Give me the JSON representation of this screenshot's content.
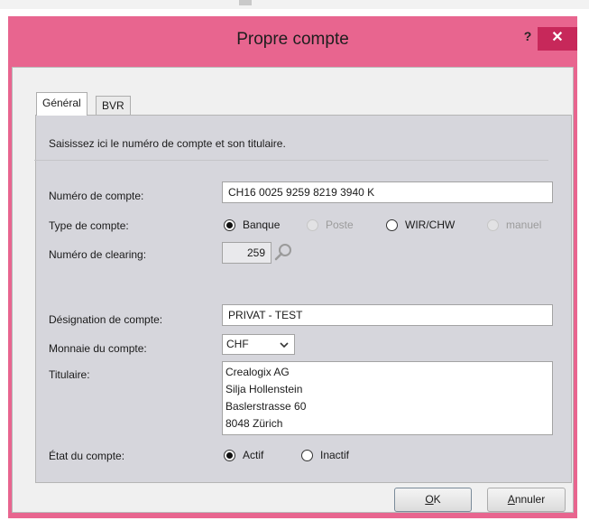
{
  "window": {
    "title": "Propre compte",
    "help_label": "?",
    "close_label": "✕"
  },
  "tabs": [
    {
      "label": "Général"
    },
    {
      "label": "BVR"
    }
  ],
  "intro": "Saisissez ici le numéro de compte et son titulaire.",
  "account_number": {
    "label": "Numéro de compte:",
    "value": "CH16 0025 9259 8219 3940 K"
  },
  "account_type": {
    "label": "Type de compte:",
    "options": [
      {
        "label": "Banque",
        "selected": true,
        "enabled": true
      },
      {
        "label": "Poste",
        "selected": false,
        "enabled": false
      },
      {
        "label": "WIR/CHW",
        "selected": false,
        "enabled": true
      },
      {
        "label": "manuel",
        "selected": false,
        "enabled": false
      }
    ]
  },
  "clearing": {
    "label": "Numéro de clearing:",
    "value": "259",
    "icon": "magnifier-icon"
  },
  "designation": {
    "label": "Désignation de compte:",
    "value": "PRIVAT - TEST"
  },
  "currency": {
    "label": "Monnaie du compte:",
    "value": "CHF",
    "icon": "chevron-down-icon"
  },
  "holder": {
    "label": "Titulaire:",
    "lines": [
      "Crealogix AG",
      "Silja Hollenstein",
      "Baslerstrasse 60",
      "8048 Zürich"
    ]
  },
  "status": {
    "label": "État du compte:",
    "options": [
      {
        "label": "Actif",
        "selected": true
      },
      {
        "label": "Inactif",
        "selected": false
      }
    ]
  },
  "buttons": {
    "ok_mnemonic": "O",
    "ok_rest": "K",
    "cancel_mnemonic": "A",
    "cancel_rest": "nnuler"
  },
  "colors": {
    "title_bar": "#e8658f",
    "close_button": "#c7285a",
    "panel": "#d6d6dc"
  }
}
